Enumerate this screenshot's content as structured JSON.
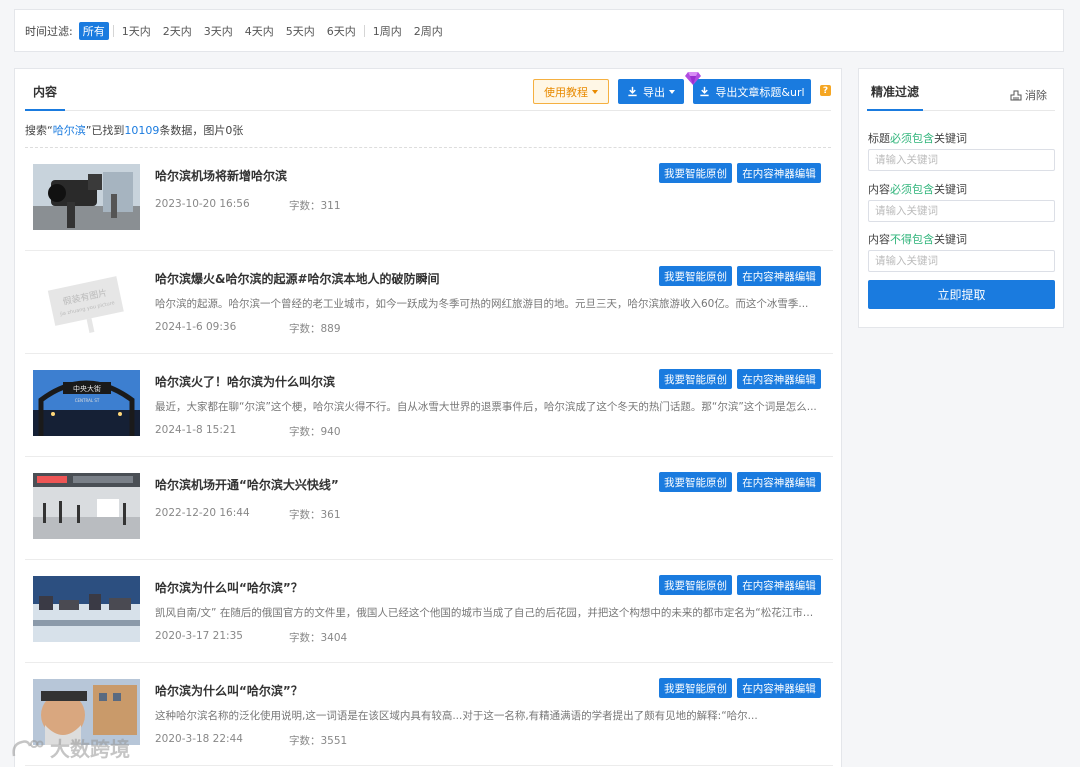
{
  "time_filter": {
    "label": "时间过滤:",
    "options": [
      "所有",
      "1天内",
      "2天内",
      "3天内",
      "4天内",
      "5天内",
      "6天内",
      "1周内",
      "2周内"
    ]
  },
  "content": {
    "tab": "内容",
    "tutorial_label": "使用教程",
    "export_label": "导出",
    "export_title_label": "导出文章标题&url",
    "help": "?",
    "summary": {
      "prefix": "搜索“",
      "keyword": "哈尔滨",
      "middle": "”已找到",
      "count": "10109",
      "suffix": "条数据，图片0张"
    },
    "btn_original": "我要智能原创",
    "btn_edit": "在内容神器编辑",
    "words_prefix": "字数：",
    "rows": [
      {
        "title": "哈尔滨机场将新增哈尔滨",
        "desc": "",
        "date": "2023-10-20 16:56",
        "words": "311"
      },
      {
        "title": "哈尔滨爆火&哈尔滨的起源#哈尔滨本地人的破防瞬间",
        "desc": "哈尔滨的起源。哈尔滨一个曾经的老工业城市，如今一跃成为冬季可热的网红旅游目的地。元旦三天，哈尔滨旅游收入60亿。而这个冰雪季...",
        "date": "2024-1-6 09:36",
        "words": "889"
      },
      {
        "title": "哈尔滨火了！哈尔滨为什么叫尔滨",
        "desc": "最近，大家都在聊“尔滨”这个梗，哈尔滨火得不行。自从冰雪大世界的退票事件后，哈尔滨成了这个冬天的热门话题。那“尔滨”这个词是怎么...",
        "date": "2024-1-8 15:21",
        "words": "940"
      },
      {
        "title": "哈尔滨机场开通“哈尔滨大兴快线”",
        "desc": "",
        "date": "2022-12-20 16:44",
        "words": "361"
      },
      {
        "title": "哈尔滨为什么叫“哈尔滨”？",
        "desc": "凯风自南/文” 在随后的俄国官方的文件里，俄国人已经这个他国的城市当成了自己的后花园，并把这个构想中的未来的都市定名为“松花江市”...",
        "date": "2020-3-17 21:35",
        "words": "3404"
      },
      {
        "title": "哈尔滨为什么叫“哈尔滨”？",
        "desc": "这种哈尔滨名称的泛化使用说明,这一词语是在该区域内具有较高...对于这一名称,有精通满语的学者提出了颇有见地的解释:“哈尔...",
        "date": "2020-3-18 22:44",
        "words": "3551"
      }
    ],
    "placeholder_image_text": [
      "假装有图片",
      "jia zhuang you picture"
    ],
    "sign_text": [
      "中央大街",
      "CENTRAL ST"
    ]
  },
  "filter": {
    "title": "精准过滤",
    "clear_label": "消除",
    "title_label": {
      "pre": "标题",
      "mid": "必须包含",
      "post": "关键词"
    },
    "content_must_label": {
      "pre": "内容",
      "mid": "必须包含",
      "post": "关键词"
    },
    "content_not_label": {
      "pre": "内容",
      "mid": "不得包含",
      "post": "关键词"
    },
    "input_placeholder": "请输入关键词",
    "submit_label": "立即提取"
  },
  "watermark": "大数跨境"
}
